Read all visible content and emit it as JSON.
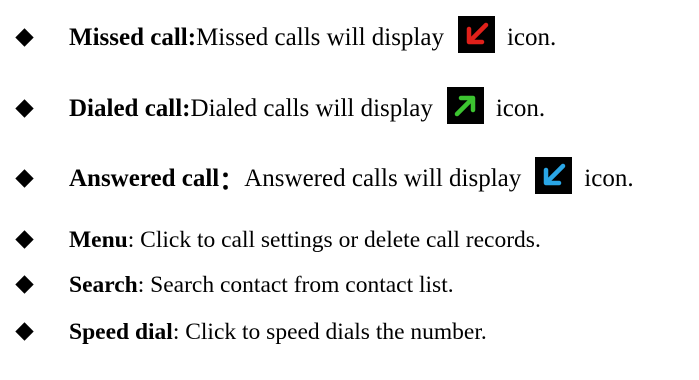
{
  "items": [
    {
      "term": "Missed call:",
      "text": " Missed calls will display",
      "icon": "missed-call-arrow-icon",
      "icon_color": "#e0201a",
      "after": "icon."
    },
    {
      "term": "Dialed call:",
      "text": " Dialed calls will display",
      "icon": "dialed-call-arrow-icon",
      "icon_color": "#3cc430",
      "after": "icon."
    },
    {
      "term": "Answered call",
      "sep": "：",
      "text": " Answered calls will display",
      "icon": "answered-call-arrow-icon",
      "icon_color": "#2aa6e6",
      "after": "icon."
    },
    {
      "term": "Menu",
      "text": ": Click to call settings or delete call records."
    },
    {
      "term": "Search",
      "text": ": Search contact from contact list."
    },
    {
      "term": "Speed dial",
      "text": ": Click to speed dials the number."
    }
  ]
}
